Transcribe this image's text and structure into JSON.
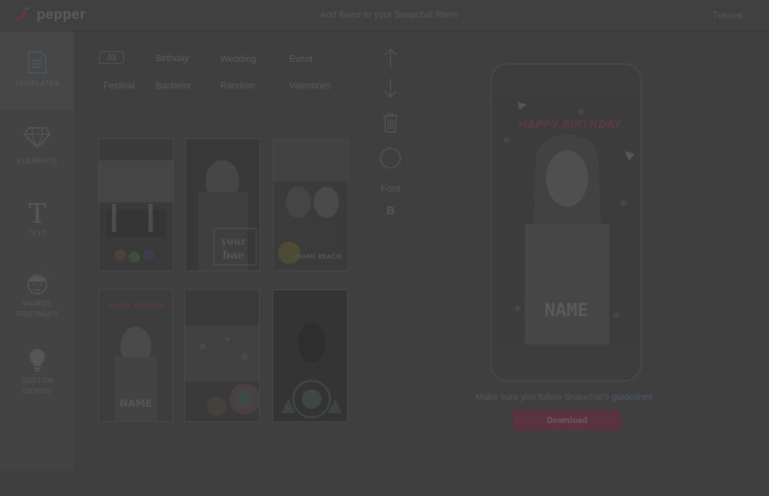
{
  "header": {
    "brand": "pepper",
    "tagline": "Add flavor to your Snapchat filters",
    "tutorial_label": "Tutorial"
  },
  "sidebar": {
    "items": [
      {
        "label": "TEMPLATES",
        "icon": "document-icon",
        "active": true
      },
      {
        "label": "ELEMENTS",
        "icon": "diamond-icon",
        "active": false
      },
      {
        "label": "TEXT",
        "icon": "text-icon",
        "active": false
      },
      {
        "label": "WORDS FOOTAGES",
        "icon": "face-icon",
        "active": false
      },
      {
        "label": "CUSTOM DESIGN",
        "icon": "bulb-icon",
        "active": false
      }
    ]
  },
  "categories": [
    "All",
    "Birthday",
    "Wedding",
    "Event",
    "Festival",
    "Bachelor",
    "Random",
    "Valentines"
  ],
  "templates": [
    {
      "caption": "",
      "theme": "party table"
    },
    {
      "caption": "your bae",
      "theme": "portrait"
    },
    {
      "caption": "MIAMI BEACH",
      "theme": "selfie"
    },
    {
      "caption": "HAPPY BIRTHDAY",
      "subcaption": "NAME",
      "theme": "birthday"
    },
    {
      "caption": "",
      "theme": "city night"
    },
    {
      "caption": "",
      "theme": "dark forest"
    }
  ],
  "tools": {
    "font_label": "Font",
    "bold_label": "B"
  },
  "preview": {
    "headline": "HAPPY BIRTHDAY",
    "name_placeholder": "NAME"
  },
  "footer": {
    "note_prefix": "Make sure you follow Snapchat's ",
    "note_link": "guidelines",
    "download_label": "Download"
  },
  "colors": {
    "overlay_background": "#3f3f3f",
    "accent": "#5a3340",
    "link": "#4f5970"
  }
}
